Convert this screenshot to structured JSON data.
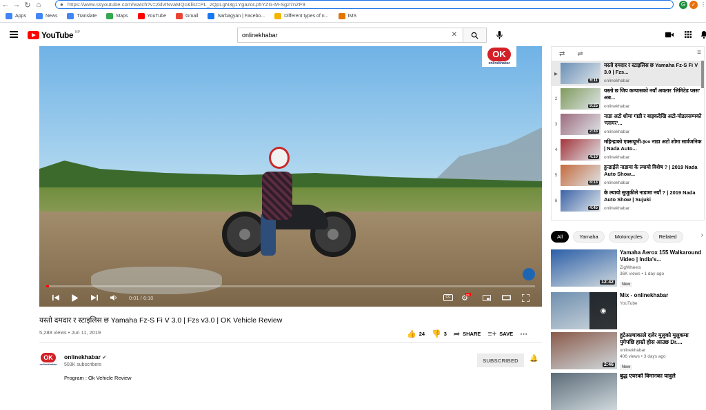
{
  "browser": {
    "url": "https://www.ssyoutube.com/watch?v=zklvtNvaMQc&list=PL_zQpLgN3g1YgazoLp5YZG-M-Sg27nZF9",
    "bookmarks": [
      {
        "label": "Apps",
        "color": "#4285f4"
      },
      {
        "label": "News",
        "color": "#4285f4"
      },
      {
        "label": "Translate",
        "color": "#4285f4"
      },
      {
        "label": "Maps",
        "color": "#34a853"
      },
      {
        "label": "YouTube",
        "color": "#ff0000"
      },
      {
        "label": "Gmail",
        "color": "#ea4335"
      },
      {
        "label": "Sarbagyan | Facebo...",
        "color": "#1877f2"
      },
      {
        "label": "Different types of n...",
        "color": "#f4b400"
      },
      {
        "label": "IMS",
        "color": "#e37400"
      }
    ]
  },
  "header": {
    "logo_text": "YouTube",
    "country_code": "NP",
    "search_value": "onlinekhabar"
  },
  "player": {
    "badge_mark": "OK",
    "badge_brand": "onlinekhabar",
    "time": "0:01 / 6:10",
    "progress": 0.003,
    "cc_label": "CC",
    "hd_label": "HD"
  },
  "video": {
    "title": "यस्तो दमदार र स्टाइलिस छ Yamaha Fz-S Fi V 3.0 | Fzs v3.0 | OK Vehicle Review",
    "meta": "5,288 views • Jun 11, 2019",
    "likes": "24",
    "dislikes": "3",
    "share_label": "SHARE",
    "save_label": "SAVE"
  },
  "channel": {
    "avatar_mark": "OK",
    "avatar_brand": "onlinekhabar",
    "name": "onlinekhabar",
    "subscribers": "503K subscribers",
    "subscribe_label": "SUBSCRIBED",
    "description": "Program : Ok Vehicle Review"
  },
  "playlist": {
    "items": [
      {
        "index": "▶",
        "title": "यस्तो दमदार र स्टाइलिस छ Yamaha Fz-S Fi V 3.0 | Fzs...",
        "channel": "onlinekhabar",
        "duration": "6:11",
        "bg": "#6a8fb5"
      },
      {
        "index": "2",
        "title": "यस्तो छ जिप कम्पासको नयाँ अवतार 'लिमिटेड प्लस' अब...",
        "channel": "onlinekhabar",
        "duration": "9:25",
        "bg": "#7f9a5c"
      },
      {
        "index": "3",
        "title": "नाडा अटो शोमा गाडी र बाइकदेखि अटो-मोडलसम्मको 'ग्लामर'...",
        "channel": "onlinekhabar",
        "duration": "2:33",
        "bg": "#9d6b7d"
      },
      {
        "index": "4",
        "title": "महिन्द्राको एक्सयूभी-३०० नाडा अटो शोमा सार्वजनिक | Nada Auto...",
        "channel": "onlinekhabar",
        "duration": "4:10",
        "bg": "#a3343a"
      },
      {
        "index": "5",
        "title": "हुन्डाईले नाडामा के ल्यायो विशेष ? | 2019 Nada Auto Show...",
        "channel": "onlinekhabar",
        "duration": "8:13",
        "bg": "#c46a3c"
      },
      {
        "index": "6",
        "title": "के ल्यायो सुजुकीले नाडामा नयाँ ? | 2019 Nada Auto Show | Sujuki",
        "channel": "onlinekhabar",
        "duration": "4:45",
        "bg": "#3d63a6"
      }
    ]
  },
  "chips": [
    {
      "label": "All",
      "active": true
    },
    {
      "label": "Yamaha",
      "active": false
    },
    {
      "label": "Motorcycles",
      "active": false
    },
    {
      "label": "Related",
      "active": false
    }
  ],
  "related": [
    {
      "title": "Yamaha Aerox 155 Walkaround Video | India's...",
      "channel": "ZigWheels",
      "meta": "36K views • 1 day ago",
      "badge": "New",
      "duration": "12:42",
      "bg": "#2c5fa8"
    },
    {
      "title": "Mix - onlinekhabar",
      "channel": "YouTube",
      "meta": "",
      "badge": "",
      "duration": "",
      "bg": "#6f8fb0"
    },
    {
      "title": "हुटेअल्याकाले दलेर मुलुको मुलुकमा पुगेपछि हाम्रो होस आउछ Dr....",
      "channel": "onlinekhabar",
      "meta": "406 views • 3 days ago",
      "badge": "New",
      "duration": "2:46",
      "bg": "#8a5a4a"
    },
    {
      "title": "बुद्ध एयरको विमानका यात्रुले",
      "channel": "",
      "meta": "",
      "badge": "",
      "duration": "",
      "bg": "#5b6b78"
    }
  ]
}
